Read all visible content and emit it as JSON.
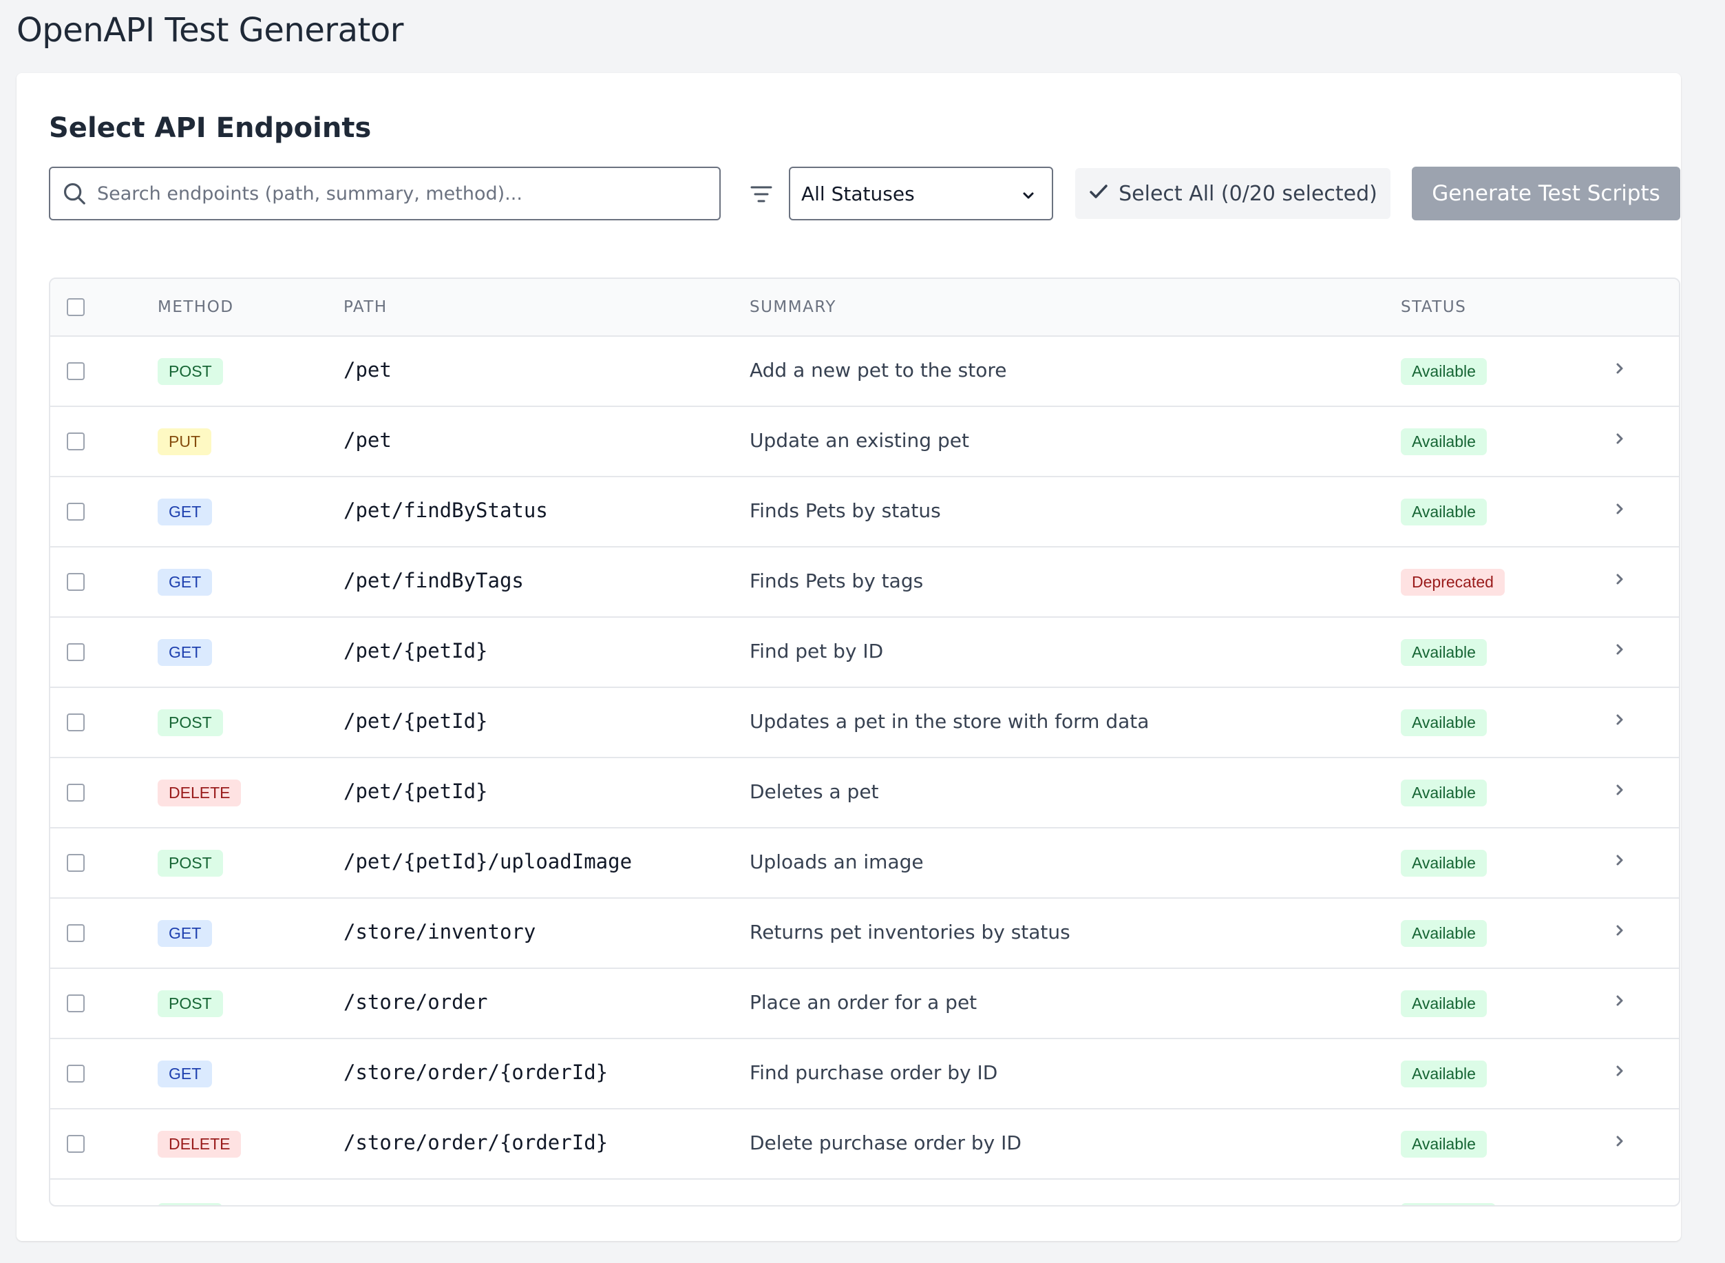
{
  "app": {
    "title": "OpenAPI Test Generator"
  },
  "section": {
    "title": "Select API Endpoints"
  },
  "toolbar": {
    "search_placeholder": "Search endpoints (path, summary, method)...",
    "search_value": "",
    "status_filter": {
      "selected": "All Statuses"
    },
    "select_all_label": "Select All (0/20 selected)",
    "generate_label": "Generate Test Scripts"
  },
  "table": {
    "columns": {
      "method": "METHOD",
      "path": "PATH",
      "summary": "SUMMARY",
      "status": "STATUS"
    },
    "rows": [
      {
        "method": "POST",
        "path": "/pet",
        "summary": "Add a new pet to the store",
        "status": "Available"
      },
      {
        "method": "PUT",
        "path": "/pet",
        "summary": "Update an existing pet",
        "status": "Available"
      },
      {
        "method": "GET",
        "path": "/pet/findByStatus",
        "summary": "Finds Pets by status",
        "status": "Available"
      },
      {
        "method": "GET",
        "path": "/pet/findByTags",
        "summary": "Finds Pets by tags",
        "status": "Deprecated"
      },
      {
        "method": "GET",
        "path": "/pet/{petId}",
        "summary": "Find pet by ID",
        "status": "Available"
      },
      {
        "method": "POST",
        "path": "/pet/{petId}",
        "summary": "Updates a pet in the store with form data",
        "status": "Available"
      },
      {
        "method": "DELETE",
        "path": "/pet/{petId}",
        "summary": "Deletes a pet",
        "status": "Available"
      },
      {
        "method": "POST",
        "path": "/pet/{petId}/uploadImage",
        "summary": "Uploads an image",
        "status": "Available"
      },
      {
        "method": "GET",
        "path": "/store/inventory",
        "summary": "Returns pet inventories by status",
        "status": "Available"
      },
      {
        "method": "POST",
        "path": "/store/order",
        "summary": "Place an order for a pet",
        "status": "Available"
      },
      {
        "method": "GET",
        "path": "/store/order/{orderId}",
        "summary": "Find purchase order by ID",
        "status": "Available"
      },
      {
        "method": "DELETE",
        "path": "/store/order/{orderId}",
        "summary": "Delete purchase order by ID",
        "status": "Available"
      }
    ]
  },
  "icons": {
    "search": "search-icon",
    "filter": "filter-icon",
    "dropdown": "chevron-down-icon",
    "check": "check-icon",
    "row_chevron": "chevron-right-icon"
  },
  "colors": {
    "background": "#f3f4f6",
    "card": "#ffffff",
    "generate_disabled": "#9ca3af",
    "post": "#dcfce7",
    "put": "#fef9c3",
    "get": "#dbeafe",
    "delete": "#fee2e2",
    "available": "#dcfce7",
    "deprecated": "#fee2e2"
  }
}
